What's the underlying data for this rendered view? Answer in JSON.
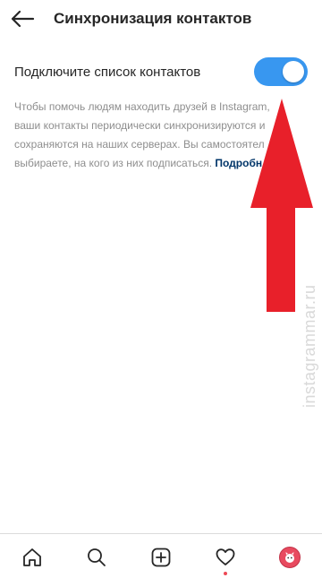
{
  "header": {
    "title": "Синхронизация контактов",
    "back_icon": "arrow-left-icon"
  },
  "sync": {
    "label": "Подключите список контактов",
    "enabled": true,
    "toggle_color": "#3897f0"
  },
  "description": {
    "lines": [
      "Чтобы помочь людям находить друзей в Instagram,",
      "ваши контакты периодически синхронизируются и",
      "сохраняются на наших серверах. Вы самостоятел",
      "выбираете, на кого из них подписаться."
    ],
    "link": "Подробн"
  },
  "annotation": {
    "type": "red-arrow-up",
    "color": "#e8202a"
  },
  "watermark": "instagrammar.ru",
  "bottom_nav": {
    "items": [
      "home-icon",
      "search-icon",
      "new-post-icon",
      "activity-heart-icon",
      "profile-avatar"
    ],
    "notification_color": "#ed4956"
  }
}
